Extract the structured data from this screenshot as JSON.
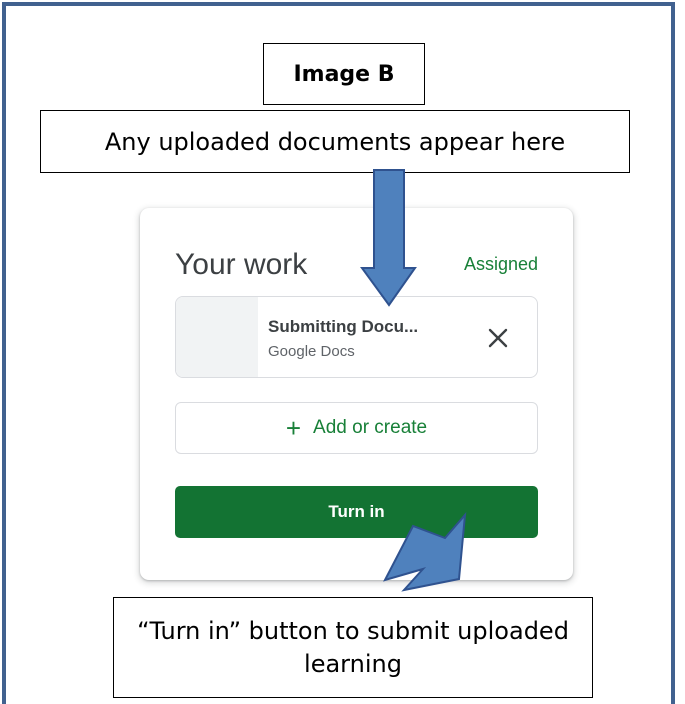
{
  "annotations": {
    "image_label": "Image B",
    "top_caption": "Any uploaded documents appear here",
    "bottom_caption": "“Turn in” button to submit uploaded learning"
  },
  "card": {
    "title": "Your work",
    "status": "Assigned",
    "attachment": {
      "name": "Submitting Docu...",
      "type": "Google Docs",
      "remove_icon": "close-icon"
    },
    "add_button": {
      "icon": "plus-icon",
      "label": "Add or create"
    },
    "turn_in_label": "Turn in"
  },
  "colors": {
    "frame": "#41618f",
    "arrow_fill": "#4f81bd",
    "arrow_stroke": "#2f528f",
    "status_green": "#188038",
    "button_green": "#137333"
  }
}
